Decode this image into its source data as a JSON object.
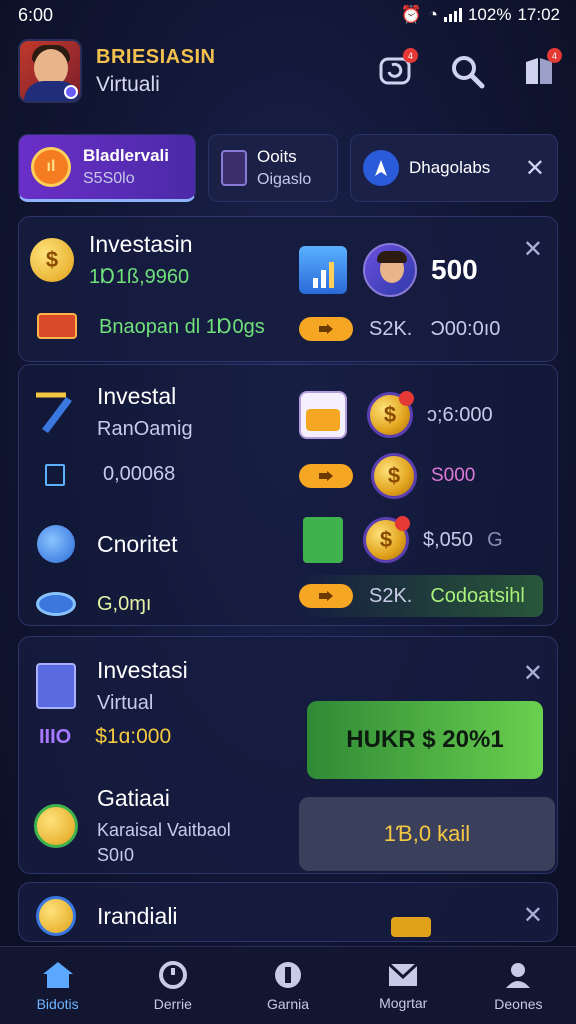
{
  "status": {
    "time": "6:00",
    "battery": "102%",
    "clock": "17:02"
  },
  "header": {
    "brand": "BRIESIASIN",
    "subtitle": "Virtuali"
  },
  "tabs": [
    {
      "title": "Bladlervali",
      "sub": "S5S0lo"
    },
    {
      "title": "Ooits",
      "sub": "Oigaslo"
    },
    {
      "title": "Dhagolabs"
    }
  ],
  "card1": {
    "title": "Investasin",
    "value": "1Ɒ1ß,9960",
    "note": "Bnaopan dl 1Ɒ0ɡs",
    "amount": "500",
    "right_text": "S2K.",
    "right_value": "Ɔ00:0ı0"
  },
  "card2": {
    "row1_title": "Investal",
    "row1_sub": "RanOamig",
    "row1_value": "ɔ;6:000",
    "row2_value": "0,00068",
    "row2_right": "S000",
    "row3_title": "Cnoritet",
    "row3_value": "$,050",
    "row3_suffix": "G",
    "row4_value": "G,0ɱı",
    "row4_right": "S2K.",
    "row4_label": "Codoatsihl"
  },
  "card3": {
    "title": "Investasi",
    "sub": "Virtual",
    "tag": "IIIO",
    "amount": "$1ɑ:000",
    "button": "HUKR $ 20%1",
    "row2_title": "Gatiaai",
    "row2_sub": "Karaisal Vaitbaol",
    "row2_code": "S0ı0",
    "button2": "1Ɓ,0 kail"
  },
  "card4": {
    "title": "Irandiali"
  },
  "nav": [
    {
      "label": "Bidotis"
    },
    {
      "label": "Derrie"
    },
    {
      "label": "Garnia"
    },
    {
      "label": "Mogrtar"
    },
    {
      "label": "Deones"
    }
  ]
}
